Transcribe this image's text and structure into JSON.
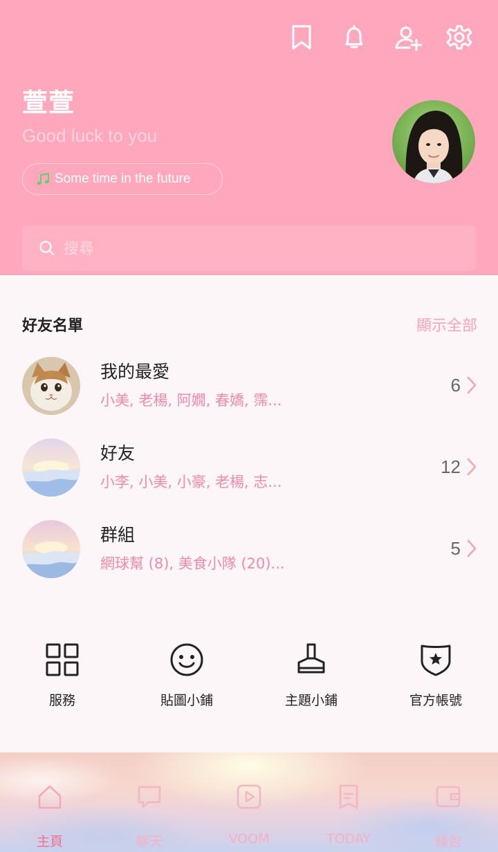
{
  "profile": {
    "name": "萱萱",
    "status": "Good luck to you",
    "music": "Some time in the future"
  },
  "search": {
    "placeholder": "搜尋"
  },
  "friends_section": {
    "title": "好友名單",
    "show_all": "顯示全部",
    "rows": [
      {
        "name": "我的最愛",
        "members": "小美, 老楊, 阿嫺, 春嬌, 霈...",
        "count": "6"
      },
      {
        "name": "好友",
        "members": "小李, 小美, 小豪, 老楊, 志...",
        "count": "12"
      },
      {
        "name": "群組",
        "members": "網球幫 (8), 美食小隊 (20)...",
        "count": "5"
      }
    ]
  },
  "services": [
    {
      "label": "服務",
      "icon": "grid-icon"
    },
    {
      "label": "貼圖小鋪",
      "icon": "smiley-icon"
    },
    {
      "label": "主題小鋪",
      "icon": "brush-icon"
    },
    {
      "label": "官方帳號",
      "icon": "shield-star-icon"
    }
  ],
  "nav": [
    {
      "label": "主頁",
      "icon": "home-icon",
      "active": true
    },
    {
      "label": "聊天",
      "icon": "chat-icon",
      "active": false
    },
    {
      "label": "VOOM",
      "icon": "voom-icon",
      "active": false
    },
    {
      "label": "TODAY",
      "icon": "today-icon",
      "active": false
    },
    {
      "label": "錢包",
      "icon": "wallet-icon",
      "active": false
    }
  ],
  "colors": {
    "header_bg": "#ffa8bd",
    "accent_pink": "#f08aa6",
    "page_bg": "#fdf6f8"
  }
}
